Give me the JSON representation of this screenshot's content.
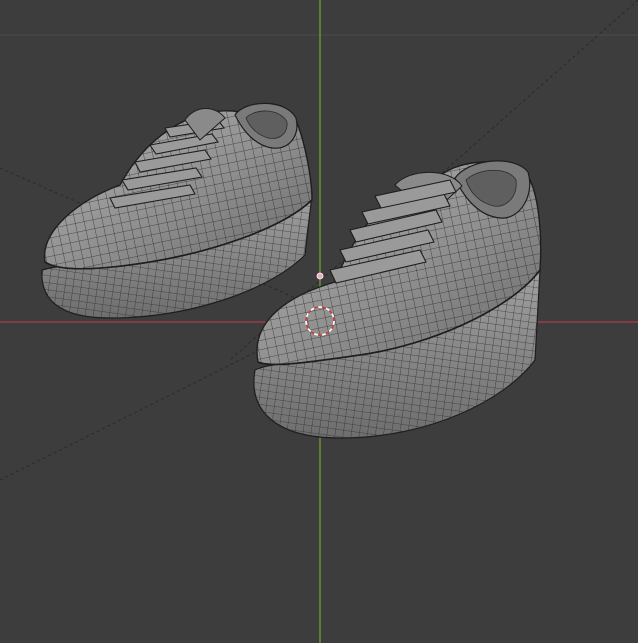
{
  "viewport": {
    "background": "#3d3d3d",
    "grid_color": "#4a4a4a",
    "x_axis_color": "#9a3c46",
    "y_axis_color": "#6a9a2e",
    "wire_color": "#2b2b2b",
    "mesh_fill": "#8e8e8e",
    "mesh_fill_light": "#a9a9a9",
    "mesh_fill_dark": "#6c6c6c"
  },
  "scene": {
    "objects": [
      "left-sneaker",
      "right-sneaker"
    ],
    "cursor_icon": "3d-cursor-icon",
    "origin_icon": "object-origin-icon"
  }
}
